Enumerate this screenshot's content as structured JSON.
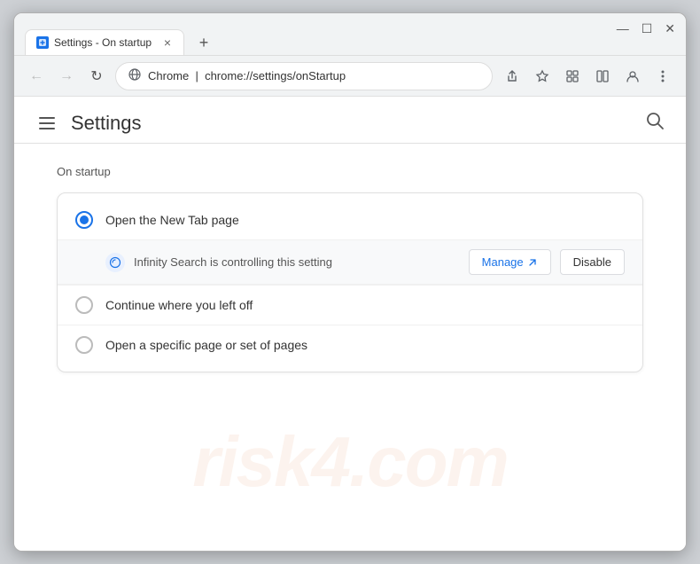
{
  "window": {
    "title": "Settings - On startup",
    "controls": {
      "minimize": "—",
      "maximize": "☐",
      "close": "✕"
    }
  },
  "tab": {
    "title": "Settings - On startup",
    "close": "×"
  },
  "addressBar": {
    "browser_label": "Chrome",
    "url_base": "chrome://settings/",
    "url_bold": "onStartup",
    "back_disabled": true,
    "forward_disabled": true
  },
  "settings": {
    "menu_icon": "☰",
    "title": "Settings",
    "search_icon": "🔍",
    "section_label": "On startup",
    "options": [
      {
        "id": "new-tab",
        "label": "Open the New Tab page",
        "selected": true
      },
      {
        "id": "continue",
        "label": "Continue where you left off",
        "selected": false
      },
      {
        "id": "specific-page",
        "label": "Open a specific page or set of pages",
        "selected": false
      }
    ],
    "sub_notice": {
      "label": "Infinity Search is controlling this setting",
      "manage_btn": "Manage",
      "disable_btn": "Disable"
    }
  },
  "watermark": "risk4.com"
}
